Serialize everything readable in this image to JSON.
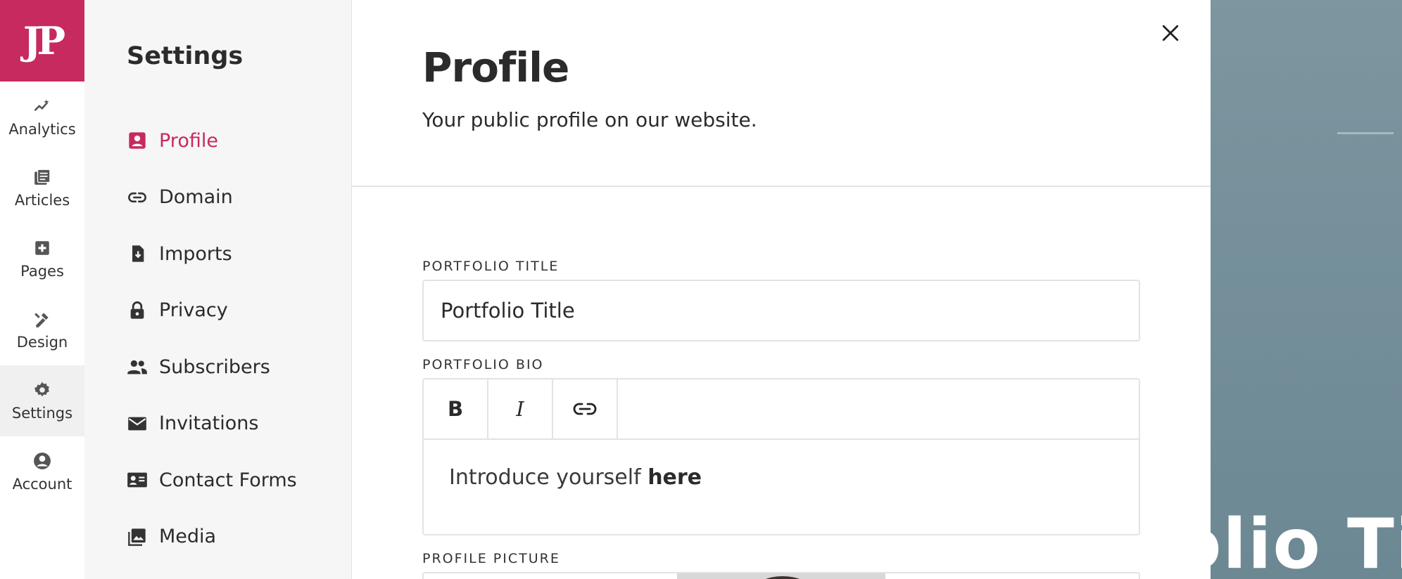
{
  "brand": {
    "logo_text": "JP",
    "accent": "#c62a5e"
  },
  "rail": {
    "items": [
      {
        "label": "Analytics",
        "icon": "analytics-icon"
      },
      {
        "label": "Articles",
        "icon": "articles-icon"
      },
      {
        "label": "Pages",
        "icon": "pages-icon"
      },
      {
        "label": "Design",
        "icon": "design-icon"
      },
      {
        "label": "Settings",
        "icon": "gear-icon",
        "active": true
      },
      {
        "label": "Account",
        "icon": "account-icon"
      }
    ]
  },
  "subnav": {
    "title": "Settings",
    "items": [
      {
        "label": "Profile",
        "icon": "profile-icon",
        "active": true
      },
      {
        "label": "Domain",
        "icon": "link-icon"
      },
      {
        "label": "Imports",
        "icon": "import-icon"
      },
      {
        "label": "Privacy",
        "icon": "lock-icon"
      },
      {
        "label": "Subscribers",
        "icon": "people-icon"
      },
      {
        "label": "Invitations",
        "icon": "mail-icon"
      },
      {
        "label": "Contact Forms",
        "icon": "contact-card-icon"
      },
      {
        "label": "Media",
        "icon": "image-icon"
      }
    ]
  },
  "main": {
    "title": "Profile",
    "subtitle": "Your public profile on our website.",
    "portfolio_title": {
      "label": "PORTFOLIO TITLE",
      "value": "Portfolio Title"
    },
    "portfolio_bio": {
      "label": "PORTFOLIO BIO",
      "toolbar": {
        "bold": "B",
        "italic": "I"
      },
      "text_plain": "Introduce yourself ",
      "text_bold": "here"
    },
    "profile_picture": {
      "label": "PROFILE PICTURE"
    }
  },
  "preview": {
    "title_fragment": "olio Ti"
  }
}
